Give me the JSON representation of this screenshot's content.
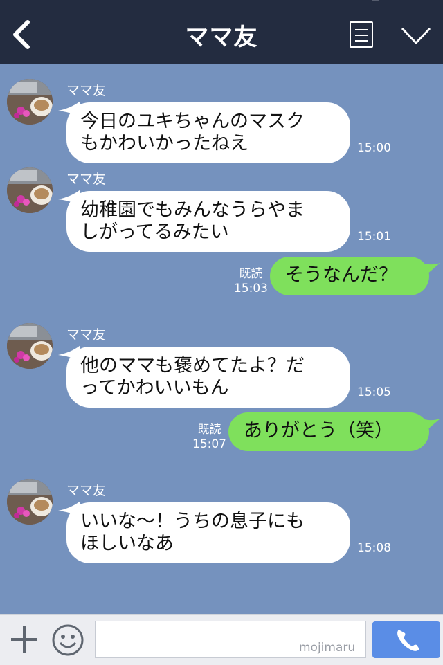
{
  "header": {
    "title": "ママ友"
  },
  "messages": [
    {
      "side": "left",
      "name": "ママ友",
      "lines": [
        "今日のユキちゃんのマスク",
        "もかわいかったねえ"
      ],
      "time": "15:00"
    },
    {
      "side": "left",
      "name": "ママ友",
      "lines": [
        "幼稚園でもみんなうらやま",
        "しがってるみたい"
      ],
      "time": "15:01"
    },
    {
      "side": "right",
      "read": "既読",
      "time": "15:03",
      "text": "そうなんだ？"
    },
    {
      "side": "left",
      "name": "ママ友",
      "lines": [
        "他のママも褒めてたよ？だ",
        "ってかわいいもん"
      ],
      "time": "15:05"
    },
    {
      "side": "right",
      "read": "既読",
      "time": "15:07",
      "text": "ありがとう（笑）"
    },
    {
      "side": "left",
      "name": "ママ友",
      "lines": [
        "いいな〜！うちの息子にも",
        "ほしいなあ"
      ],
      "time": "15:08"
    }
  ],
  "input": {
    "value": "",
    "watermark": "mojimaru"
  },
  "colors": {
    "header": "#232c40",
    "background": "#7592be",
    "my_bubble": "#7fe05c",
    "call_button": "#5a8de6"
  },
  "icons": {
    "back": "chevron-left-icon",
    "menu": "list-icon",
    "collapse": "chevron-down-icon",
    "plus": "plus-icon",
    "emoji": "smiley-icon",
    "call": "phone-icon"
  }
}
